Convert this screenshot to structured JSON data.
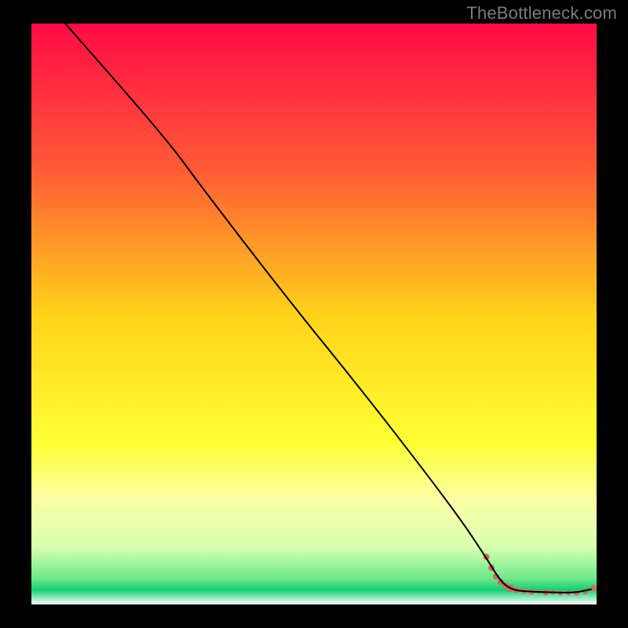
{
  "watermark": "TheBottleneck.com",
  "chart_data": {
    "type": "line",
    "title": "",
    "xlabel": "",
    "ylabel": "",
    "xlim": [
      0,
      100
    ],
    "ylim": [
      0,
      100
    ],
    "grid": false,
    "background_gradient": {
      "stops": [
        {
          "offset": 0.0,
          "color": "#ff0b45"
        },
        {
          "offset": 0.25,
          "color": "#ff5a36"
        },
        {
          "offset": 0.5,
          "color": "#ffd21a"
        },
        {
          "offset": 0.72,
          "color": "#ffff33"
        },
        {
          "offset": 0.82,
          "color": "#fbffa6"
        },
        {
          "offset": 0.9,
          "color": "#d9ffb0"
        },
        {
          "offset": 0.955,
          "color": "#6fe98a"
        },
        {
          "offset": 0.975,
          "color": "#14cf74"
        },
        {
          "offset": 1.0,
          "color": "#ffffff"
        }
      ]
    },
    "series": [
      {
        "name": "curve",
        "stroke": "#000000",
        "stroke_width": 2,
        "points": [
          {
            "x": 6.0,
            "y": 100.0
          },
          {
            "x": 24.0,
            "y": 80.0
          },
          {
            "x": 30.0,
            "y": 72.0
          },
          {
            "x": 45.0,
            "y": 53.0
          },
          {
            "x": 60.0,
            "y": 35.0
          },
          {
            "x": 75.0,
            "y": 16.0
          },
          {
            "x": 80.5,
            "y": 8.0
          },
          {
            "x": 83.0,
            "y": 4.0
          },
          {
            "x": 85.0,
            "y": 2.5
          },
          {
            "x": 88.0,
            "y": 2.2
          },
          {
            "x": 92.0,
            "y": 2.1
          },
          {
            "x": 96.0,
            "y": 2.0
          },
          {
            "x": 99.0,
            "y": 2.6
          }
        ]
      }
    ],
    "scatter": {
      "name": "flat-cluster",
      "color": "#d16a63",
      "points": [
        {
          "x": 80.5,
          "y": 8.2,
          "r": 4
        },
        {
          "x": 81.4,
          "y": 6.3,
          "r": 4
        },
        {
          "x": 82.2,
          "y": 4.8,
          "r": 4
        },
        {
          "x": 83.0,
          "y": 3.9,
          "r": 4
        },
        {
          "x": 83.8,
          "y": 3.3,
          "r": 4
        },
        {
          "x": 84.7,
          "y": 2.8,
          "r": 5
        },
        {
          "x": 85.8,
          "y": 2.5,
          "r": 4
        },
        {
          "x": 87.1,
          "y": 2.3,
          "r": 4
        },
        {
          "x": 88.5,
          "y": 2.2,
          "r": 4
        },
        {
          "x": 89.8,
          "y": 2.2,
          "r": 3
        },
        {
          "x": 91.0,
          "y": 2.1,
          "r": 4
        },
        {
          "x": 92.3,
          "y": 2.1,
          "r": 3.5
        },
        {
          "x": 93.6,
          "y": 2.0,
          "r": 3.5
        },
        {
          "x": 95.0,
          "y": 2.0,
          "r": 3.5
        },
        {
          "x": 96.5,
          "y": 2.0,
          "r": 3.5
        },
        {
          "x": 98.0,
          "y": 2.2,
          "r": 3.5
        },
        {
          "x": 99.4,
          "y": 2.8,
          "r": 4
        }
      ]
    }
  }
}
